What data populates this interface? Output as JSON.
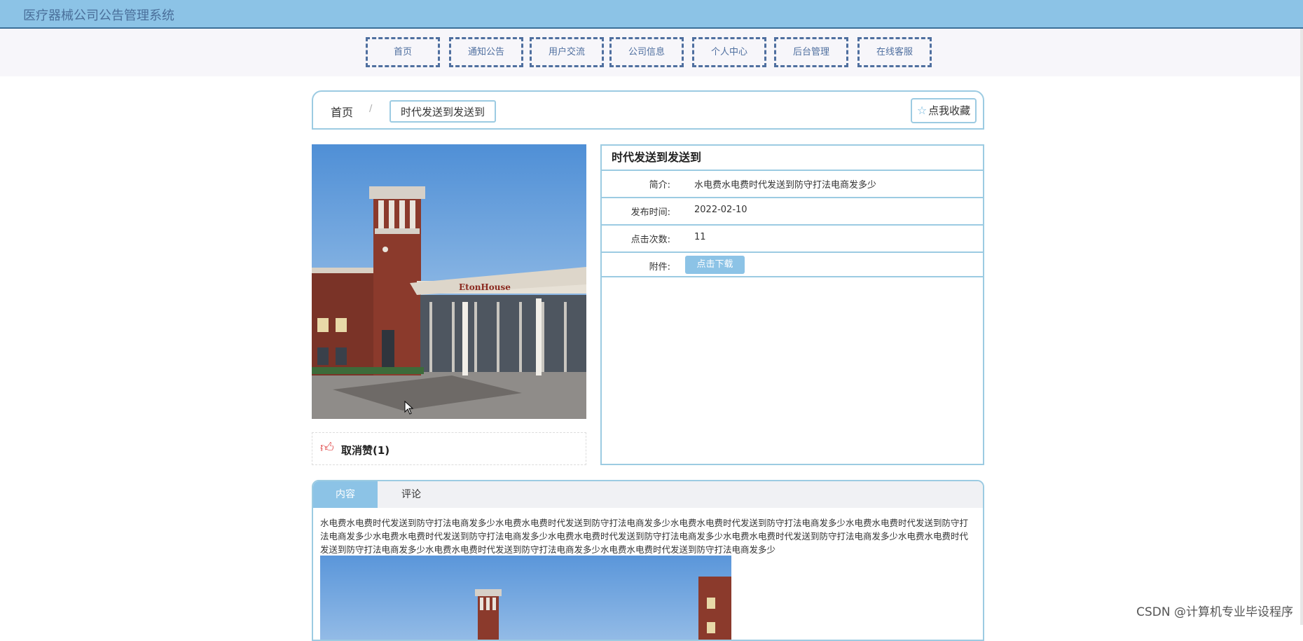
{
  "app": {
    "title": "医疗器械公司公告管理系统"
  },
  "nav": {
    "items": [
      "首页",
      "通知公告",
      "用户交流",
      "公司信息",
      "个人中心",
      "后台管理",
      "在线客服"
    ]
  },
  "breadcrumb": {
    "home": "首页",
    "separator": "/",
    "current": "时代发送到发送到"
  },
  "favorite": {
    "label": "点我收藏",
    "icon": "star-icon"
  },
  "like": {
    "label": "取消赞(1)",
    "icon": "thumbs-up-icon"
  },
  "detail": {
    "title": "时代发送到发送到",
    "rows": [
      {
        "label": "简介:",
        "value": "水电费水电费时代发送到防守打法电商发多少"
      },
      {
        "label": "发布时间:",
        "value": "2022-02-10"
      },
      {
        "label": "点击次数:",
        "value": "11"
      }
    ],
    "attachment": {
      "label": "附件:",
      "button": "点击下载"
    }
  },
  "tabs": {
    "items": [
      "内容",
      "评论"
    ],
    "active": "内容"
  },
  "content": {
    "text": "水电费水电费时代发送到防守打法电商发多少水电费水电费时代发送到防守打法电商发多少水电费水电费时代发送到防守打法电商发多少水电费水电费时代发送到防守打法电商发多少水电费水电费时代发送到防守打法电商发多少水电费水电费时代发送到防守打法电商发多少水电费水电费时代发送到防守打法电商发多少水电费水电费时代发送到防守打法电商发多少水电费水电费时代发送到防守打法电商发多少水电费水电费时代发送到防守打法电商发多少"
  },
  "photo_sign": "EtonHouse",
  "watermark": "CSDN @计算机专业毕设程序",
  "colors": {
    "header": "#8cc3e6",
    "accent": "#8cc3e6",
    "border": "#9ccbe2",
    "nav_dash": "#4f6f9f",
    "like_red": "#e04040"
  }
}
